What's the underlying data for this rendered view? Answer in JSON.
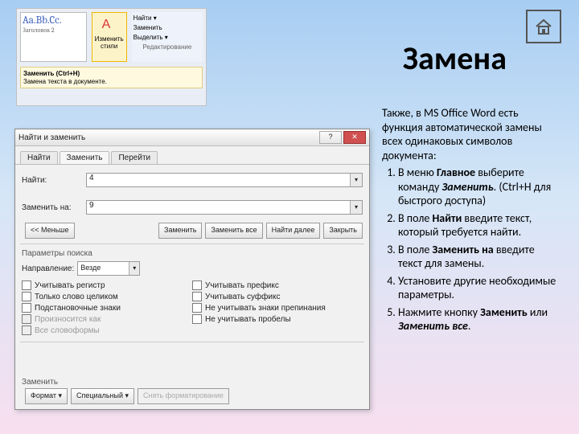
{
  "title": "Замена",
  "article": {
    "intro": "Также, в MS Office Word есть функция автоматической замены всех одинаковых символов документа:",
    "items": [
      {
        "pre": "В меню ",
        "b": "Главное",
        "post": " выберите команду ",
        "i": "Заменить",
        "tail": ". (Ctrl+H для быстрого доступа)"
      },
      {
        "pre": "В поле ",
        "b": "Найти",
        "post": " введите текст, который требуется найти.",
        "i": "",
        "tail": ""
      },
      {
        "pre": "В поле ",
        "b": "Заменить на",
        "post": " введите текст для замены.",
        "i": "",
        "tail": ""
      },
      {
        "pre": "Установите другие необходимые параметры.",
        "b": "",
        "post": "",
        "i": "",
        "tail": ""
      },
      {
        "pre": "Нажмите кнопку ",
        "b": "Заменить",
        "post": " или ",
        "i": "Заменить все",
        "tail": "."
      }
    ]
  },
  "ribbon": {
    "styles_sample": "Aa.Bb.Cc.",
    "styles_caption": "Заголовок 2",
    "changebtn": "Изменить стили",
    "edit_find": "Найти ▾",
    "edit_replace": "Заменить",
    "edit_select": "Выделить ▾",
    "edit_section": "Редактирование",
    "tooltip_title": "Заменить (Ctrl+H)",
    "tooltip_body": "Замена текста в документе."
  },
  "dlg": {
    "title": "Найти и заменить",
    "tabs": [
      "Найти",
      "Заменить",
      "Перейти"
    ],
    "find_label": "Найти:",
    "find_value": "4",
    "replace_label": "Заменить на:",
    "replace_value": "9",
    "btn_less": "<< Меньше",
    "btn_replace": "Заменить",
    "btn_replace_all": "Заменить все",
    "btn_find_next": "Найти далее",
    "btn_cancel": "Закрыть",
    "section_options": "Параметры поиска",
    "direction_label": "Направление:",
    "direction_value": "Везде",
    "opts_left": [
      "Учитывать регистр",
      "Только слово целиком",
      "Подстановочные знаки",
      "Произносится как",
      "Все словоформы"
    ],
    "opts_right": [
      "Учитывать префикс",
      "Учитывать суффикс",
      "Не учитывать знаки препинания",
      "Не учитывать пробелы"
    ],
    "section_replace": "Заменить",
    "btn_format": "Формат ▾",
    "btn_special": "Специальный ▾",
    "btn_noformat": "Снять форматирование"
  }
}
